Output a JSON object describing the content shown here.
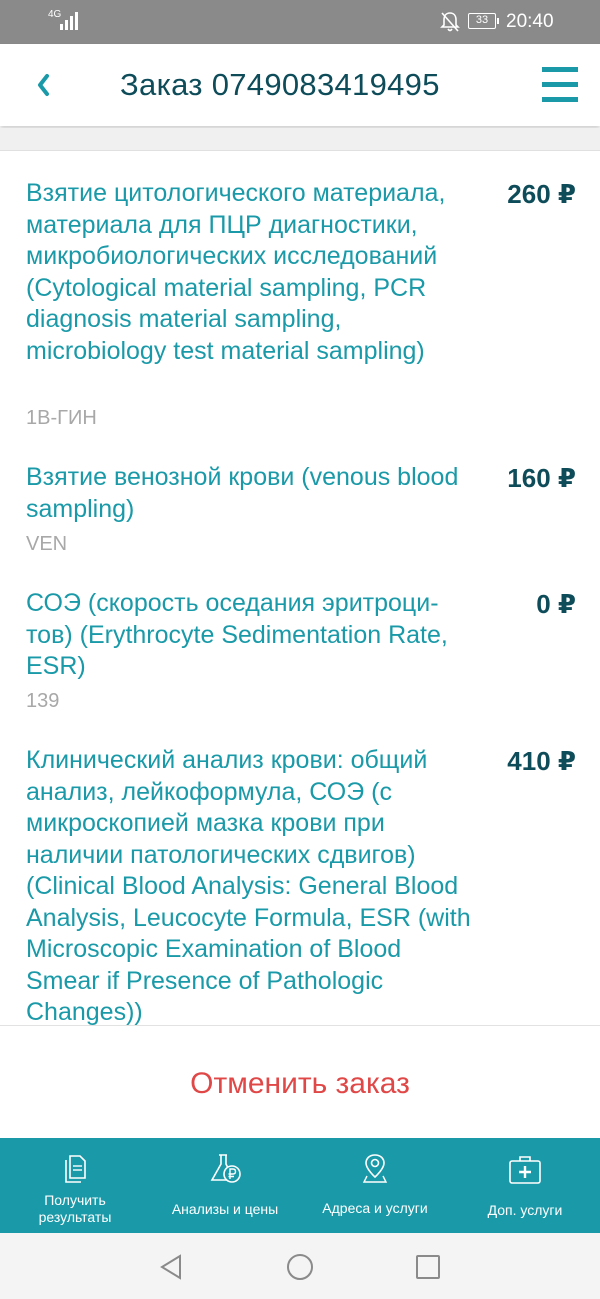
{
  "status_bar": {
    "network": "4G",
    "battery": "33",
    "time": "20:40"
  },
  "header": {
    "title": "Заказ 0749083419495",
    "back_icon": "chevron-left-icon",
    "menu_icon": "hamburger-menu-icon"
  },
  "items": [
    {
      "name": "Взятие цитологического материала, материала для ПЦР диагностики, микробиологических исследований (Cytological material sampling, PCR diagnosis material sampling, microbiology test material sampling)",
      "code": "1В-ГИН",
      "price": "260 ₽"
    },
    {
      "name": "Взятие венозной крови (venous blood sampling)",
      "code": "VEN",
      "price": "160 ₽"
    },
    {
      "name": "СОЭ (скорость оседания эритроци-тов) (Erythrocyte Sedimentation Rate, ESR)",
      "code": "139",
      "price": "0 ₽"
    },
    {
      "name": "Клинический анализ крови: общий анализ, лейкоформула, СОЭ (с микроскопией мазка крови при наличии патологических сдвигов) (Clinical Blood Analysis: General Blood Analysis, Leucocyte Formula, ESR (with Microscopic Examination of Blood Smear if Presence of Pathologic Changes))",
      "code": "",
      "price": "410 ₽"
    }
  ],
  "cancel_label": "Отменить заказ",
  "nav": [
    {
      "label": "Получить результаты",
      "icon": "documents-icon"
    },
    {
      "label": "Анализы и цены",
      "icon": "flask-ruble-icon"
    },
    {
      "label": "Адреса и услуги",
      "icon": "map-pin-icon"
    },
    {
      "label": "Доп. услуги",
      "icon": "medical-kit-icon"
    }
  ],
  "colors": {
    "accent": "#1a9aa8",
    "title_dark": "#0e4c5a",
    "danger": "#e04848",
    "muted": "#a8a8a8"
  }
}
